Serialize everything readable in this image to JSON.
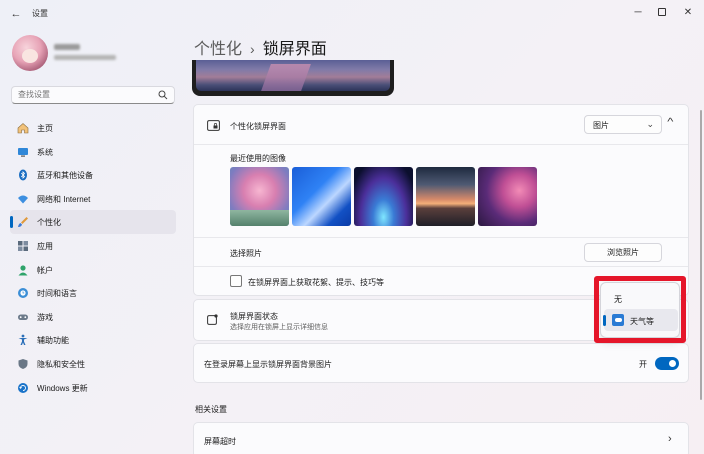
{
  "titlebar": {
    "app_title": "设置",
    "back_icon": "arrow-left-icon",
    "minimize_icon": "minimize-icon",
    "maximize_icon": "maximize-icon",
    "close_icon": "close-icon"
  },
  "search": {
    "placeholder": "查找设置"
  },
  "sidebar": {
    "items": [
      {
        "label": "主页",
        "icon": "home-icon"
      },
      {
        "label": "系统",
        "icon": "monitor-icon"
      },
      {
        "label": "蓝牙和其他设备",
        "icon": "bluetooth-icon"
      },
      {
        "label": "网络和 Internet",
        "icon": "wifi-icon"
      },
      {
        "label": "个性化",
        "icon": "brush-icon",
        "active": true
      },
      {
        "label": "应用",
        "icon": "apps-icon"
      },
      {
        "label": "帐户",
        "icon": "person-icon"
      },
      {
        "label": "时间和语言",
        "icon": "globe-clock-icon"
      },
      {
        "label": "游戏",
        "icon": "gamepad-icon"
      },
      {
        "label": "辅助功能",
        "icon": "accessibility-icon"
      },
      {
        "label": "隐私和安全性",
        "icon": "shield-icon"
      },
      {
        "label": "Windows 更新",
        "icon": "update-icon"
      }
    ]
  },
  "header": {
    "parent": "个性化",
    "separator": "›",
    "current": "锁屏界面"
  },
  "lock_screen": {
    "title": "个性化锁屏界面",
    "select_value": "图片",
    "recent_label": "最近使用的图像",
    "choose_label": "选择照片",
    "browse_button": "浏览照片",
    "tips_label": "在锁屏界面上获取花絮、提示、技巧等"
  },
  "status": {
    "title": "锁屏界面状态",
    "subtitle": "选择应用在锁屏上显示详细信息"
  },
  "signin_bg": {
    "label": "在登录屏幕上显示锁屏界面背景图片",
    "toggle_label": "开",
    "toggle_on": true
  },
  "related": {
    "title": "相关设置",
    "screen_timeout": "屏幕超时"
  },
  "dropdown": {
    "options": [
      "无",
      "天气等"
    ],
    "selected": "天气等"
  },
  "colors": {
    "accent": "#0067c0",
    "highlight": "#e5162a"
  }
}
